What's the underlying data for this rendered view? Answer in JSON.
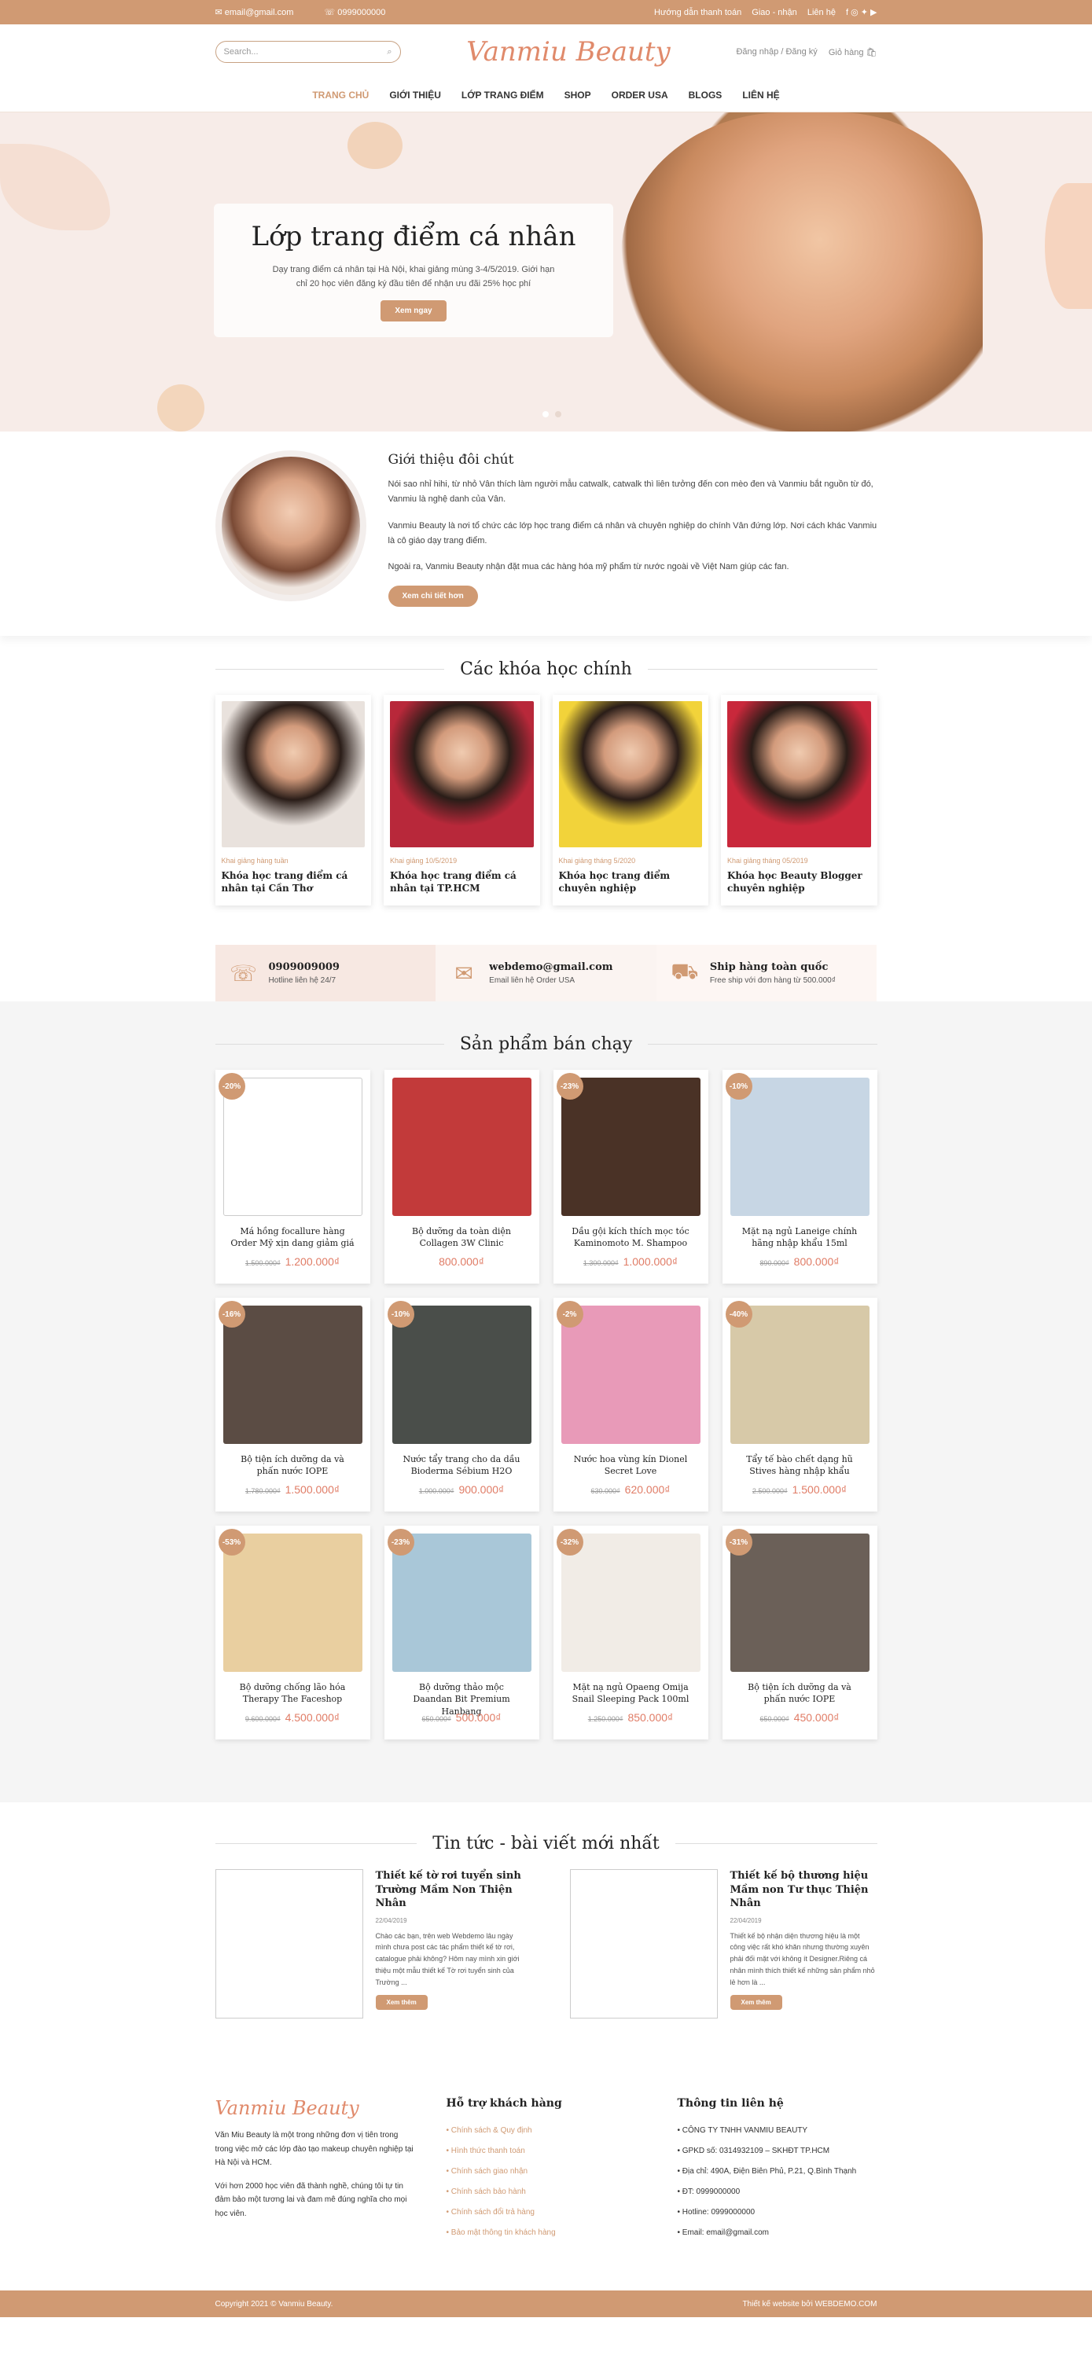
{
  "topbar": {
    "email": "email@gmail.com",
    "phone": "0999000000",
    "links": [
      "Hướng dẫn thanh toán",
      "Giao - nhận",
      "Liên hệ"
    ]
  },
  "header": {
    "search_placeholder": "Search...",
    "logo": "Vanmiu Beauty",
    "login": "Đăng nhập / Đăng ký",
    "cart": "Giỏ hàng"
  },
  "nav": [
    "TRANG CHỦ",
    "GIỚI THIỆU",
    "LỚP TRANG ĐIỂM",
    "SHOP",
    "ORDER USA",
    "BLOGS",
    "LIÊN HỆ"
  ],
  "hero": {
    "title": "Lớp trang điểm cá nhân",
    "text": "Dạy trang điểm cá nhân tại Hà Nội, khai giảng mùng 3-4/5/2019. Giới hạn chỉ 20 học viên đăng ký đầu tiên để nhận ưu đãi 25% học phí",
    "button": "Xem ngay"
  },
  "about": {
    "title": "Giới thiệu đôi chút",
    "p1": "Nói sao nhỉ hihi, từ nhỏ Vân thích làm người mẫu catwalk, catwalk thì liên tưởng đến con mèo đen và Vanmiu bắt nguồn từ đó, Vanmiu là nghệ danh của Vân.",
    "p2": "Vanmiu Beauty là nơi tổ chức các lớp học trang điểm cá nhân và chuyên nghiệp do chính Vân đứng lớp. Nơi cách khác Vanmiu là cô giáo dạy trang điểm.",
    "p3": "Ngoài ra, Vanmiu Beauty nhận đặt mua các hàng hóa mỹ phẩm từ nước ngoài về Việt Nam giúp các fan.",
    "button": "Xem chi tiết hơn"
  },
  "courses": {
    "title": "Các khóa học chính",
    "items": [
      {
        "date": "Khai giảng hàng tuần",
        "title": "Khóa học trang điểm cá nhân tại Cần Thơ",
        "color": "#e9e2dd"
      },
      {
        "date": "Khai giảng 10/5/2019",
        "title": "Khóa học trang điểm cá nhân tại TP.HCM",
        "color": "#b8283a"
      },
      {
        "date": "Khai giảng tháng 5/2020",
        "title": "Khóa học trang điểm chuyên nghiệp",
        "color": "#f2d33a"
      },
      {
        "date": "Khai giảng tháng 05/2019",
        "title": "Khóa học Beauty Blogger chuyên nghiệp",
        "color": "#c9283b"
      }
    ]
  },
  "strip": [
    {
      "head": "0909009009",
      "sub": "Hotline liên hệ 24/7",
      "icon": "☏"
    },
    {
      "head": "webdemo@gmail.com",
      "sub": "Email liên hệ Order USA",
      "icon": "✉"
    },
    {
      "head": "Ship hàng toàn quốc",
      "sub": "Free ship với đơn hàng từ 500.000₫",
      "icon": "⛟"
    }
  ],
  "products": {
    "title": "Sản phẩm bán chạy",
    "items": [
      {
        "badge": "-20%",
        "name": "Má hồng focallure hàng Order Mỹ xịn dang giảm giá",
        "old": "1.500.000₫",
        "price": "1.200.000₫",
        "color": "#ffffff"
      },
      {
        "badge": "",
        "name": "Bộ dưỡng da toàn diện Collagen 3W Clinic",
        "old": "",
        "price": "800.000₫",
        "color": "#c23a3a"
      },
      {
        "badge": "-23%",
        "name": "Dầu gội kích thích mọc tóc Kaminomoto M. Shampoo",
        "old": "1.300.000₫",
        "price": "1.000.000₫",
        "color": "#4a3226"
      },
      {
        "badge": "-10%",
        "name": "Mặt nạ ngủ Laneige chính hãng nhập khẩu 15ml",
        "old": "890.000₫",
        "price": "800.000₫",
        "color": "#c7d6e4"
      },
      {
        "badge": "-16%",
        "name": "Bộ tiện ích dưỡng da và phấn nước IOPE",
        "old": "1.780.000₫",
        "price": "1.500.000₫",
        "color": "#5b4c44"
      },
      {
        "badge": "-10%",
        "name": "Nước tẩy trang cho da dầu Bioderma Sébium H2O",
        "old": "1.000.000₫",
        "price": "900.000₫",
        "color": "#4a4e4a"
      },
      {
        "badge": "-2%",
        "name": "Nước hoa vùng kín Dionel Secret Love",
        "old": "630.000₫",
        "price": "620.000₫",
        "color": "#e89ab8"
      },
      {
        "badge": "-40%",
        "name": "Tẩy tế bào chết dạng hũ Stives hàng nhập khẩu",
        "old": "2.500.000₫",
        "price": "1.500.000₫",
        "color": "#d7c9a8"
      },
      {
        "badge": "-53%",
        "name": "Bộ dưỡng chống lão hóa Therapy The Faceshop",
        "old": "9.600.000₫",
        "price": "4.500.000₫",
        "color": "#e9cfa0"
      },
      {
        "badge": "-23%",
        "name": "Bộ dưỡng thảo mộc Daandan Bit Premium Hanbang",
        "old": "650.000₫",
        "price": "500.000₫",
        "color": "#a9c7d8"
      },
      {
        "badge": "-32%",
        "name": "Mặt nạ ngủ Opaeng Omija Snail Sleeping Pack 100ml",
        "old": "1.250.000₫",
        "price": "850.000₫",
        "color": "#f1ece6"
      },
      {
        "badge": "-31%",
        "name": "Bộ tiện ích dưỡng da và phấn nước IOPE",
        "old": "650.000₫",
        "price": "450.000₫",
        "color": "#6b6058"
      }
    ]
  },
  "news": {
    "title": "Tin tức - bài viết mới nhất",
    "items": [
      {
        "title": "Thiết kế tờ rơi tuyển sinh Trường Mầm Non Thiện Nhân",
        "date": "22/04/2019",
        "text": "Chào các bạn, trên web Webdemo lâu ngày mình chưa post các tác phẩm thiết kế tờ rơi, catalogue phải không? Hôm nay mình xin giới thiệu một mẫu thiết kế Tờ rơi tuyển sinh của Trường ...",
        "button": "Xem thêm"
      },
      {
        "title": "Thiết kế bộ thương hiệu Mầm non Tư thục Thiện Nhân",
        "date": "22/04/2019",
        "text": "Thiết kế bộ nhận diện thương hiệu là một công việc rất khó khăn nhưng thường xuyên phải đối mặt với không ít Designer.Riêng cá nhân mình thích thiết kế những sản phẩm nhỏ lẻ hơn là ...",
        "button": "Xem thêm"
      }
    ]
  },
  "footer": {
    "logo": "Vanmiu Beauty",
    "p1": "Văn Miu Beauty là một trong những đơn vị tiên trong trong việc mở các lớp đào tạo makeup chuyên nghiệp tại Hà Nội và HCM.",
    "p2": "Với hơn 2000 học viên đã thành nghề, chúng tôi tự tin đảm bảo một tương lai và đam mê đúng nghĩa cho mọi học viên.",
    "support_title": "Hỗ trợ khách hàng",
    "support": [
      "Chính sách & Quy định",
      "Hình thức thanh toán",
      "Chính sách giao nhận",
      "Chính sách bảo hành",
      "Chính sách đổi trả hàng",
      "Bảo mật thông tin khách hàng"
    ],
    "contact_title": "Thông tin liên hệ",
    "contact": [
      "CÔNG TY TNHH VANMIU BEAUTY",
      "GPKD số: 0314932109 – SKHĐT TP.HCM",
      "Địa chỉ: 490A, Điện Biên Phủ, P.21, Q.Bình Thạnh",
      "ĐT: 0999000000",
      "Hotline: 0999000000",
      "Email: email@gmail.com"
    ],
    "copyright": "Copyright 2021 © Vanmiu Beauty.",
    "credit": "Thiết kế website bởi WEBDEMO.COM"
  }
}
